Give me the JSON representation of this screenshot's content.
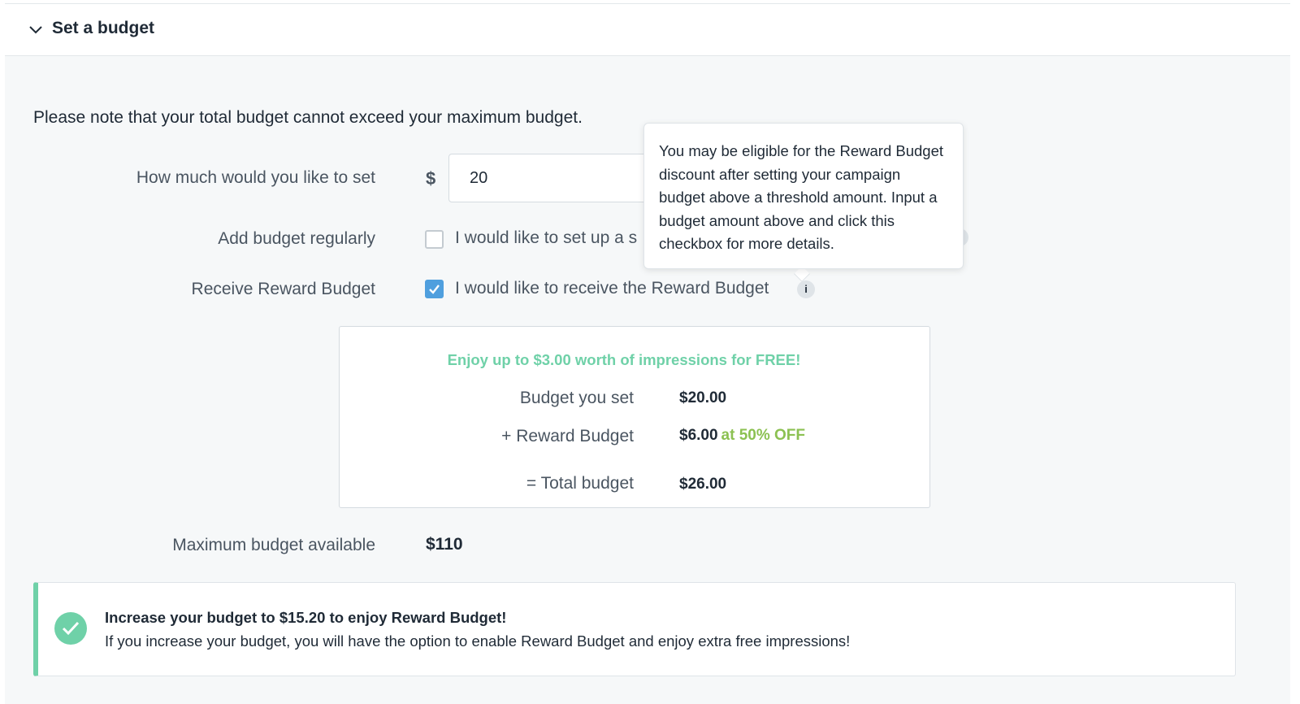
{
  "section": {
    "title": "Set a budget",
    "notice": "Please note that your total budget cannot exceed your maximum budget."
  },
  "form": {
    "amount_label": "How much would you like to set",
    "currency_symbol": "$",
    "amount_value": "20",
    "regular_label": "Add budget regularly",
    "regular_checkbox_text": "I would like to set up a s",
    "regular_checked": false,
    "reward_label": "Receive Reward Budget",
    "reward_checkbox_text": "I would like to receive the Reward Budget",
    "reward_checked": true,
    "info_icon": "i"
  },
  "tooltip": {
    "text": "You may be eligible for the Reward Budget discount after setting your campaign budget above a threshold amount. Input a budget amount above and click this checkbox for more details."
  },
  "reward_summary": {
    "promo": "Enjoy up to $3.00 worth of impressions for FREE!",
    "rows": [
      {
        "label": "Budget you set",
        "value": "$20.00",
        "note": ""
      },
      {
        "label": "+ Reward Budget",
        "value": "$6.00",
        "note": "at 50% OFF"
      },
      {
        "label": "= Total budget",
        "value": "$26.00",
        "note": ""
      }
    ]
  },
  "max_budget": {
    "label": "Maximum budget available",
    "value": "$110"
  },
  "alert": {
    "title": "Increase your budget to $15.20 to enjoy Reward Budget!",
    "body": "If you increase your budget, you will have the option to enable Reward Budget and enjoy extra free impressions!"
  },
  "colors": {
    "accent_green": "#6fd1a8",
    "discount_green": "#8cc152",
    "checkbox_blue": "#4f9fde"
  }
}
